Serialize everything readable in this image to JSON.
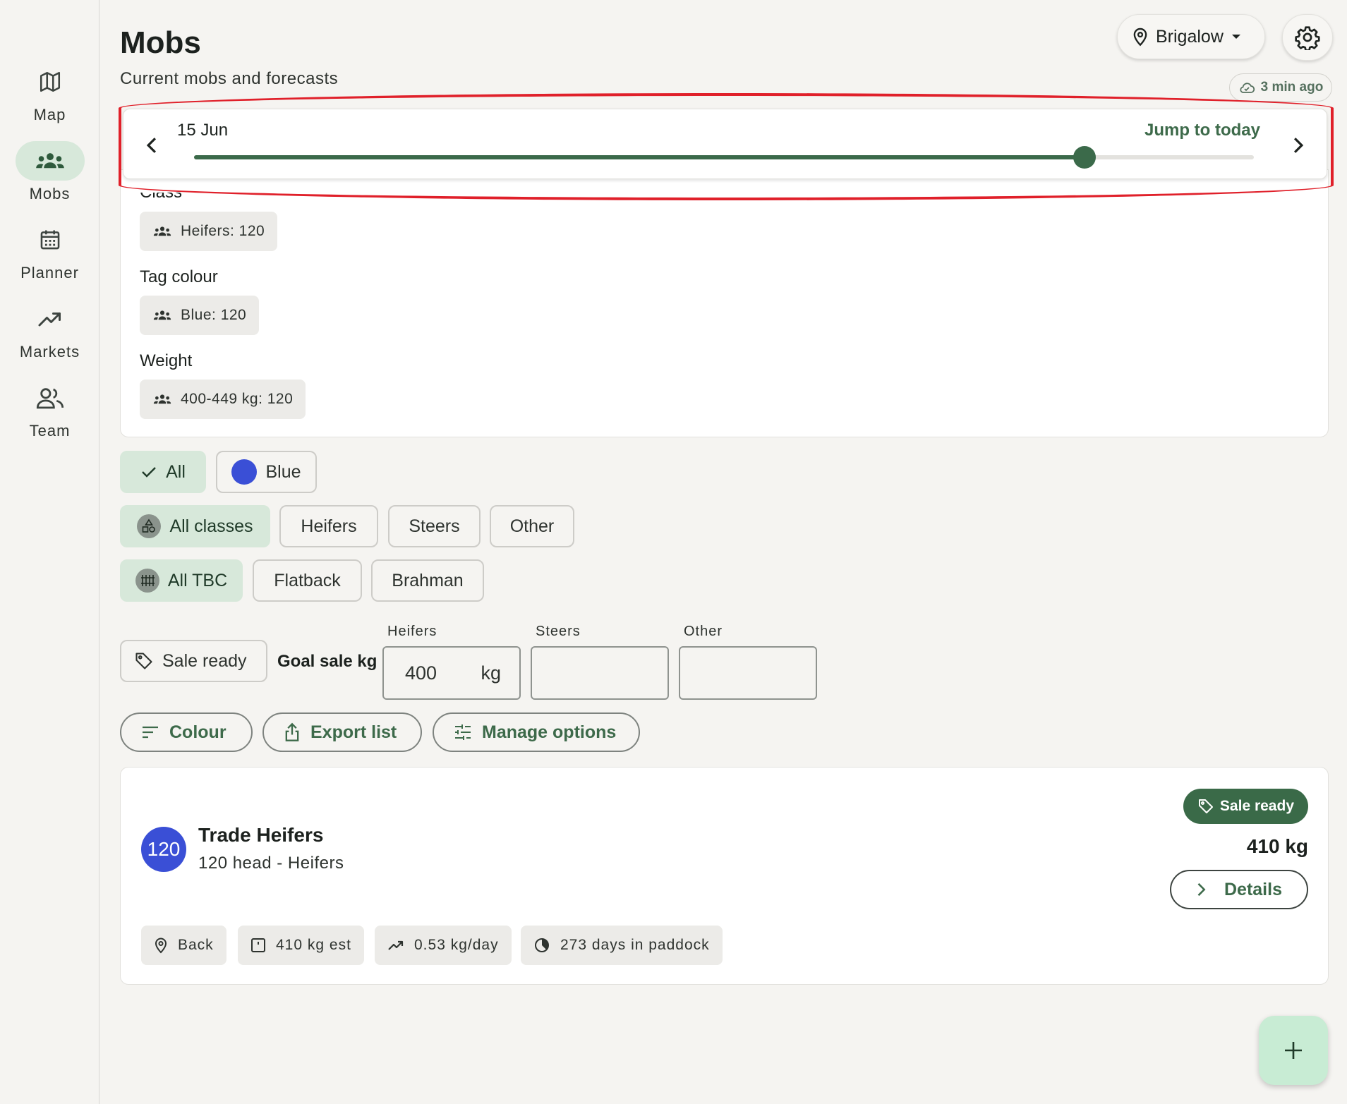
{
  "nav": {
    "items": [
      {
        "label": "Map",
        "icon": "map-icon"
      },
      {
        "label": "Mobs",
        "icon": "group-icon",
        "active": true
      },
      {
        "label": "Planner",
        "icon": "calendar-icon"
      },
      {
        "label": "Markets",
        "icon": "trend-icon"
      },
      {
        "label": "Team",
        "icon": "people-icon"
      }
    ]
  },
  "header": {
    "title": "Mobs",
    "subtitle": "Current mobs and forecasts",
    "location": "Brigalow",
    "sync_status": "3 min ago"
  },
  "date_slider": {
    "date": "15 Jun",
    "jump_label": "Jump to today",
    "position_fraction": 0.84
  },
  "summary": {
    "class_label": "Class",
    "class_chip": "Heifers: 120",
    "tag_label": "Tag colour",
    "tag_chip": "Blue: 120",
    "weight_label": "Weight",
    "weight_chip": "400-449 kg: 120"
  },
  "filters": {
    "tags": [
      {
        "label": "All",
        "selected": true
      },
      {
        "label": "Blue",
        "color": "#3a4fd6"
      }
    ],
    "classes": [
      {
        "label": "All classes",
        "selected": true
      },
      {
        "label": "Heifers"
      },
      {
        "label": "Steers"
      },
      {
        "label": "Other"
      }
    ],
    "breeds": [
      {
        "label": "All TBC",
        "selected": true
      },
      {
        "label": "Flatback"
      },
      {
        "label": "Brahman"
      }
    ]
  },
  "goal": {
    "sale_ready_label": "Sale ready",
    "goal_label": "Goal sale kg",
    "fields": [
      {
        "caption": "Heifers",
        "value": "400",
        "unit": "kg"
      },
      {
        "caption": "Steers",
        "value": "",
        "unit": ""
      },
      {
        "caption": "Other",
        "value": "",
        "unit": ""
      }
    ]
  },
  "actions": {
    "colour": "Colour",
    "export": "Export list",
    "manage": "Manage options"
  },
  "mob": {
    "count": "120",
    "name": "Trade Heifers",
    "meta": "120 head - Heifers",
    "badge": "Sale ready",
    "weight": "410 kg",
    "details": "Details",
    "stats": {
      "paddock": "Back",
      "weight_est": "410 kg est",
      "gain": "0.53 kg/day",
      "days": "273 days in paddock"
    }
  },
  "colors": {
    "accent": "#3b6a4a",
    "highlight": "#e0202a",
    "blue_tag": "#3a4fd6"
  }
}
